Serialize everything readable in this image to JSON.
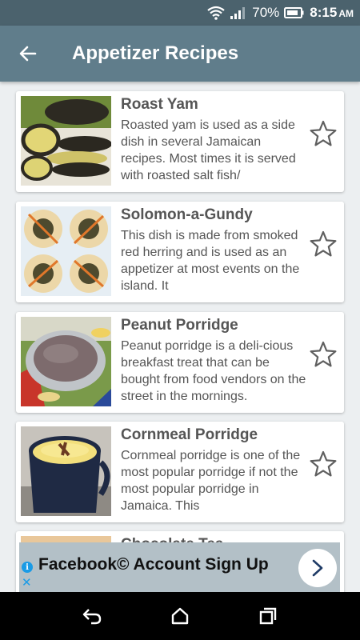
{
  "status_bar": {
    "battery_percent": "70%",
    "time": "8:15",
    "ampm": "AM",
    "icons": [
      "wifi-icon",
      "signal-icon",
      "battery-icon"
    ]
  },
  "app_bar": {
    "title": "Appetizer Recipes",
    "back_icon": "arrow-left-icon"
  },
  "recipes": [
    {
      "title": "Roast Yam",
      "description": "Roasted yam is used as a side dish in several Jamaican recipes. Most times it is served with roasted salt fish/",
      "favorite": false
    },
    {
      "title": "Solomon-a-Gundy",
      "description": "This dish is made from smoked red herring and is used as an appetizer at most events on the island. It",
      "favorite": false
    },
    {
      "title": "Peanut Porridge",
      "description": "Peanut porridge is a deli-cious breakfast treat that can be bought from food vendors on the street in the mornings.",
      "favorite": false
    },
    {
      "title": "Cornmeal Porridge",
      "description": "Cornmeal porridge is one of the most popular porridge if not the most popular porridge in Jamaica. This",
      "favorite": false
    },
    {
      "title": "Chocolate Tea",
      "description": "",
      "favorite": false
    }
  ],
  "ad": {
    "text": "Facebook© Account Sign Up",
    "info_icon": "info-icon",
    "close_icon": "close-icon",
    "arrow_icon": "chevron-right-icon"
  },
  "nav_bar": {
    "icons": [
      "back-icon",
      "home-icon",
      "recents-icon"
    ]
  },
  "colors": {
    "status_bar": "#4b626d",
    "app_bar": "#607d8b",
    "background": "#eceff1",
    "ad_background": "#b3c0c7",
    "ad_accent": "#1a9be6"
  }
}
